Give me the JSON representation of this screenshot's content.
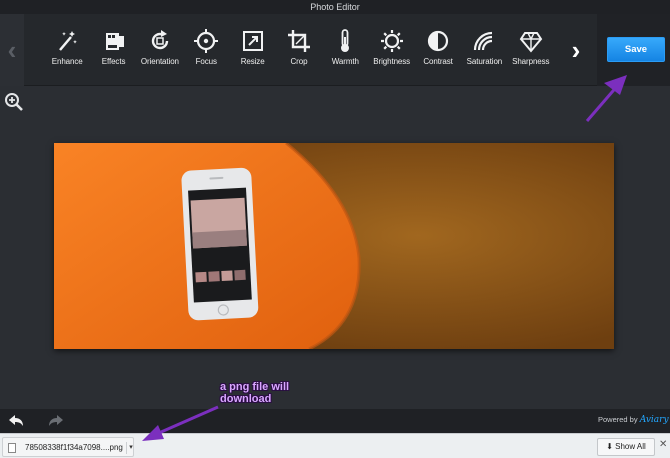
{
  "window": {
    "title": "Photo Editor"
  },
  "toolbar": {
    "tools": [
      {
        "label": "Enhance",
        "icon": "magic-wand-icon"
      },
      {
        "label": "Effects",
        "icon": "film-icon"
      },
      {
        "label": "Orientation",
        "icon": "rotate-icon"
      },
      {
        "label": "Focus",
        "icon": "focus-icon"
      },
      {
        "label": "Resize",
        "icon": "resize-icon"
      },
      {
        "label": "Crop",
        "icon": "crop-icon"
      },
      {
        "label": "Warmth",
        "icon": "thermometer-icon"
      },
      {
        "label": "Brightness",
        "icon": "sun-icon"
      },
      {
        "label": "Contrast",
        "icon": "contrast-icon"
      },
      {
        "label": "Saturation",
        "icon": "saturation-icon"
      },
      {
        "label": "Sharpness",
        "icon": "diamond-icon"
      }
    ],
    "save_label": "Save"
  },
  "annotation": {
    "text": "a png file will download"
  },
  "footer": {
    "powered_by": "Powered by",
    "brand": "Aviary"
  },
  "downloads": {
    "file_name": "78508338f1f34a7098....png",
    "show_all_label": "Show All"
  },
  "colors": {
    "accent": "#1f8ef1",
    "annotation": "#7b2fbe",
    "photo_background": "#f4761c"
  }
}
